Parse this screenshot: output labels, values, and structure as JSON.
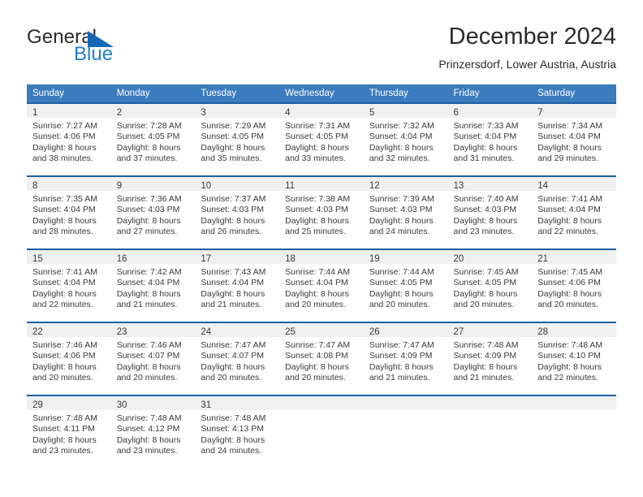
{
  "brand": {
    "name_part1": "General",
    "name_part2": "Blue",
    "logo_icon": "triangle-flag-icon",
    "accent_color": "#1f7fd0"
  },
  "header": {
    "month_title": "December 2024",
    "location": "Prinzersdorf, Lower Austria, Austria"
  },
  "calendar": {
    "header_color": "#3a7cbe",
    "grid_line_color": "#1f5fa0",
    "daynum_band_color": "#f0f0f0",
    "weekday_headers": [
      "Sunday",
      "Monday",
      "Tuesday",
      "Wednesday",
      "Thursday",
      "Friday",
      "Saturday"
    ],
    "weeks": [
      [
        {
          "day": "1",
          "sunrise": "Sunrise: 7:27 AM",
          "sunset": "Sunset: 4:06 PM",
          "daylight_line1": "Daylight: 8 hours",
          "daylight_line2": "and 38 minutes."
        },
        {
          "day": "2",
          "sunrise": "Sunrise: 7:28 AM",
          "sunset": "Sunset: 4:05 PM",
          "daylight_line1": "Daylight: 8 hours",
          "daylight_line2": "and 37 minutes."
        },
        {
          "day": "3",
          "sunrise": "Sunrise: 7:29 AM",
          "sunset": "Sunset: 4:05 PM",
          "daylight_line1": "Daylight: 8 hours",
          "daylight_line2": "and 35 minutes."
        },
        {
          "day": "4",
          "sunrise": "Sunrise: 7:31 AM",
          "sunset": "Sunset: 4:05 PM",
          "daylight_line1": "Daylight: 8 hours",
          "daylight_line2": "and 33 minutes."
        },
        {
          "day": "5",
          "sunrise": "Sunrise: 7:32 AM",
          "sunset": "Sunset: 4:04 PM",
          "daylight_line1": "Daylight: 8 hours",
          "daylight_line2": "and 32 minutes."
        },
        {
          "day": "6",
          "sunrise": "Sunrise: 7:33 AM",
          "sunset": "Sunset: 4:04 PM",
          "daylight_line1": "Daylight: 8 hours",
          "daylight_line2": "and 31 minutes."
        },
        {
          "day": "7",
          "sunrise": "Sunrise: 7:34 AM",
          "sunset": "Sunset: 4:04 PM",
          "daylight_line1": "Daylight: 8 hours",
          "daylight_line2": "and 29 minutes."
        }
      ],
      [
        {
          "day": "8",
          "sunrise": "Sunrise: 7:35 AM",
          "sunset": "Sunset: 4:04 PM",
          "daylight_line1": "Daylight: 8 hours",
          "daylight_line2": "and 28 minutes."
        },
        {
          "day": "9",
          "sunrise": "Sunrise: 7:36 AM",
          "sunset": "Sunset: 4:03 PM",
          "daylight_line1": "Daylight: 8 hours",
          "daylight_line2": "and 27 minutes."
        },
        {
          "day": "10",
          "sunrise": "Sunrise: 7:37 AM",
          "sunset": "Sunset: 4:03 PM",
          "daylight_line1": "Daylight: 8 hours",
          "daylight_line2": "and 26 minutes."
        },
        {
          "day": "11",
          "sunrise": "Sunrise: 7:38 AM",
          "sunset": "Sunset: 4:03 PM",
          "daylight_line1": "Daylight: 8 hours",
          "daylight_line2": "and 25 minutes."
        },
        {
          "day": "12",
          "sunrise": "Sunrise: 7:39 AM",
          "sunset": "Sunset: 4:03 PM",
          "daylight_line1": "Daylight: 8 hours",
          "daylight_line2": "and 24 minutes."
        },
        {
          "day": "13",
          "sunrise": "Sunrise: 7:40 AM",
          "sunset": "Sunset: 4:03 PM",
          "daylight_line1": "Daylight: 8 hours",
          "daylight_line2": "and 23 minutes."
        },
        {
          "day": "14",
          "sunrise": "Sunrise: 7:41 AM",
          "sunset": "Sunset: 4:04 PM",
          "daylight_line1": "Daylight: 8 hours",
          "daylight_line2": "and 22 minutes."
        }
      ],
      [
        {
          "day": "15",
          "sunrise": "Sunrise: 7:41 AM",
          "sunset": "Sunset: 4:04 PM",
          "daylight_line1": "Daylight: 8 hours",
          "daylight_line2": "and 22 minutes."
        },
        {
          "day": "16",
          "sunrise": "Sunrise: 7:42 AM",
          "sunset": "Sunset: 4:04 PM",
          "daylight_line1": "Daylight: 8 hours",
          "daylight_line2": "and 21 minutes."
        },
        {
          "day": "17",
          "sunrise": "Sunrise: 7:43 AM",
          "sunset": "Sunset: 4:04 PM",
          "daylight_line1": "Daylight: 8 hours",
          "daylight_line2": "and 21 minutes."
        },
        {
          "day": "18",
          "sunrise": "Sunrise: 7:44 AM",
          "sunset": "Sunset: 4:04 PM",
          "daylight_line1": "Daylight: 8 hours",
          "daylight_line2": "and 20 minutes."
        },
        {
          "day": "19",
          "sunrise": "Sunrise: 7:44 AM",
          "sunset": "Sunset: 4:05 PM",
          "daylight_line1": "Daylight: 8 hours",
          "daylight_line2": "and 20 minutes."
        },
        {
          "day": "20",
          "sunrise": "Sunrise: 7:45 AM",
          "sunset": "Sunset: 4:05 PM",
          "daylight_line1": "Daylight: 8 hours",
          "daylight_line2": "and 20 minutes."
        },
        {
          "day": "21",
          "sunrise": "Sunrise: 7:45 AM",
          "sunset": "Sunset: 4:06 PM",
          "daylight_line1": "Daylight: 8 hours",
          "daylight_line2": "and 20 minutes."
        }
      ],
      [
        {
          "day": "22",
          "sunrise": "Sunrise: 7:46 AM",
          "sunset": "Sunset: 4:06 PM",
          "daylight_line1": "Daylight: 8 hours",
          "daylight_line2": "and 20 minutes."
        },
        {
          "day": "23",
          "sunrise": "Sunrise: 7:46 AM",
          "sunset": "Sunset: 4:07 PM",
          "daylight_line1": "Daylight: 8 hours",
          "daylight_line2": "and 20 minutes."
        },
        {
          "day": "24",
          "sunrise": "Sunrise: 7:47 AM",
          "sunset": "Sunset: 4:07 PM",
          "daylight_line1": "Daylight: 8 hours",
          "daylight_line2": "and 20 minutes."
        },
        {
          "day": "25",
          "sunrise": "Sunrise: 7:47 AM",
          "sunset": "Sunset: 4:08 PM",
          "daylight_line1": "Daylight: 8 hours",
          "daylight_line2": "and 20 minutes."
        },
        {
          "day": "26",
          "sunrise": "Sunrise: 7:47 AM",
          "sunset": "Sunset: 4:09 PM",
          "daylight_line1": "Daylight: 8 hours",
          "daylight_line2": "and 21 minutes."
        },
        {
          "day": "27",
          "sunrise": "Sunrise: 7:48 AM",
          "sunset": "Sunset: 4:09 PM",
          "daylight_line1": "Daylight: 8 hours",
          "daylight_line2": "and 21 minutes."
        },
        {
          "day": "28",
          "sunrise": "Sunrise: 7:48 AM",
          "sunset": "Sunset: 4:10 PM",
          "daylight_line1": "Daylight: 8 hours",
          "daylight_line2": "and 22 minutes."
        }
      ],
      [
        {
          "day": "29",
          "sunrise": "Sunrise: 7:48 AM",
          "sunset": "Sunset: 4:11 PM",
          "daylight_line1": "Daylight: 8 hours",
          "daylight_line2": "and 23 minutes."
        },
        {
          "day": "30",
          "sunrise": "Sunrise: 7:48 AM",
          "sunset": "Sunset: 4:12 PM",
          "daylight_line1": "Daylight: 8 hours",
          "daylight_line2": "and 23 minutes."
        },
        {
          "day": "31",
          "sunrise": "Sunrise: 7:48 AM",
          "sunset": "Sunset: 4:13 PM",
          "daylight_line1": "Daylight: 8 hours",
          "daylight_line2": "and 24 minutes."
        },
        {
          "day": "",
          "sunrise": "",
          "sunset": "",
          "daylight_line1": "",
          "daylight_line2": ""
        },
        {
          "day": "",
          "sunrise": "",
          "sunset": "",
          "daylight_line1": "",
          "daylight_line2": ""
        },
        {
          "day": "",
          "sunrise": "",
          "sunset": "",
          "daylight_line1": "",
          "daylight_line2": ""
        },
        {
          "day": "",
          "sunrise": "",
          "sunset": "",
          "daylight_line1": "",
          "daylight_line2": ""
        }
      ]
    ]
  }
}
